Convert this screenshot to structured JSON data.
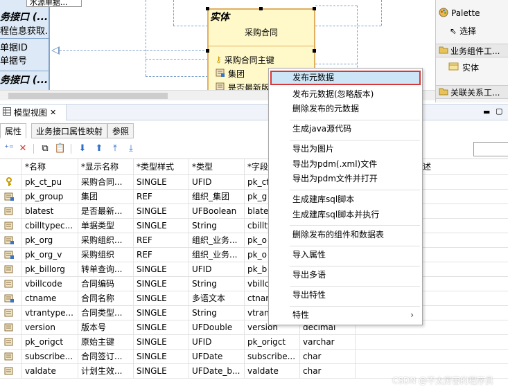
{
  "diagram": {
    "left_mini_tab": "水源单据...",
    "left_box_title_1": "务接口 (...",
    "left_box_text_1": "程信息获取...",
    "left_box_rows": [
      "单据ID",
      "单据号"
    ],
    "left_box_title_2": "务接口 (...",
    "entity": {
      "keyword": "实体",
      "name": "采购合同",
      "attributes": [
        "采购合同主键",
        "集团",
        "是否最新版"
      ]
    }
  },
  "palette": {
    "title": "Palette",
    "select_label": "选择",
    "group1_label": "业务组件工...",
    "entity_label": "实体",
    "group2_label": "关联关系工..."
  },
  "view": {
    "tab_label": "模型视图",
    "subtabs": [
      "属性",
      "业务接口属性映射",
      "参照"
    ]
  },
  "table": {
    "headers": [
      "*名称",
      "*显示名称",
      "*类型样式",
      "*类型",
      "*字段",
      "",
      "述"
    ],
    "rows": [
      {
        "name": "pk_ct_pu",
        "display": "采购合同...",
        "style": "SINGLE",
        "type": "UFID",
        "field": "pk_ct",
        "dbtype": ""
      },
      {
        "name": "pk_group",
        "display": "集团",
        "style": "REF",
        "type": "组织_集团",
        "field": "pk_g",
        "dbtype": ""
      },
      {
        "name": "blatest",
        "display": "是否最新...",
        "style": "SINGLE",
        "type": "UFBoolean",
        "field": "blate",
        "dbtype": ""
      },
      {
        "name": "cbilltypec...",
        "display": "单据类型",
        "style": "SINGLE",
        "type": "String",
        "field": "cbillty",
        "dbtype": ""
      },
      {
        "name": "pk_org",
        "display": "采购组织...",
        "style": "REF",
        "type": "组织_业务...",
        "field": "pk_o",
        "dbtype": ""
      },
      {
        "name": "pk_org_v",
        "display": "采购组织",
        "style": "REF",
        "type": "组织_业务...",
        "field": "pk_o",
        "dbtype": ""
      },
      {
        "name": "pk_billorg",
        "display": "转单查询...",
        "style": "SINGLE",
        "type": "UFID",
        "field": "pk_b",
        "dbtype": ""
      },
      {
        "name": "vbillcode",
        "display": "合同编码",
        "style": "SINGLE",
        "type": "String",
        "field": "vbillc",
        "dbtype": ""
      },
      {
        "name": "ctname",
        "display": "合同名称",
        "style": "SINGLE",
        "type": "多语文本",
        "field": "ctnar",
        "dbtype": ""
      },
      {
        "name": "vtrantype...",
        "display": "合同类型...",
        "style": "SINGLE",
        "type": "String",
        "field": "vtran",
        "dbtype": ""
      },
      {
        "name": "version",
        "display": "版本号",
        "style": "SINGLE",
        "type": "UFDouble",
        "field": "version",
        "dbtype": "decimal"
      },
      {
        "name": "pk_origct",
        "display": "原始主键",
        "style": "SINGLE",
        "type": "UFID",
        "field": "pk_origct",
        "dbtype": "varchar"
      },
      {
        "name": "subscribe...",
        "display": "合同签订...",
        "style": "SINGLE",
        "type": "UFDate",
        "field": "subscribe...",
        "dbtype": "char"
      },
      {
        "name": "valdate",
        "display": "计划生效...",
        "style": "SINGLE",
        "type": "UFDate_b...",
        "field": "valdate",
        "dbtype": "char"
      }
    ]
  },
  "context_menu": {
    "items": [
      "发布元数据",
      "发布元数据(忽略版本)",
      "删除发布的元数据",
      "生成java源代码",
      "导出为图片",
      "导出为pdm(.xml)文件",
      "导出为pdm文件并打开",
      "生成建库sql脚本",
      "生成建库sql脚本并执行",
      "删除发布的组件和数据表",
      "导入属性",
      "导出多语",
      "导出特性",
      "特性"
    ]
  },
  "watermark": "CSDN @不太厉害的程序员",
  "colors": {
    "menu_highlight_border": "#d93636",
    "menu_highlight_bg": "#cde6f7",
    "entity_bg": "#fff8c8",
    "entity_border": "#e0b060",
    "interface_bg": "#dde9f6"
  }
}
